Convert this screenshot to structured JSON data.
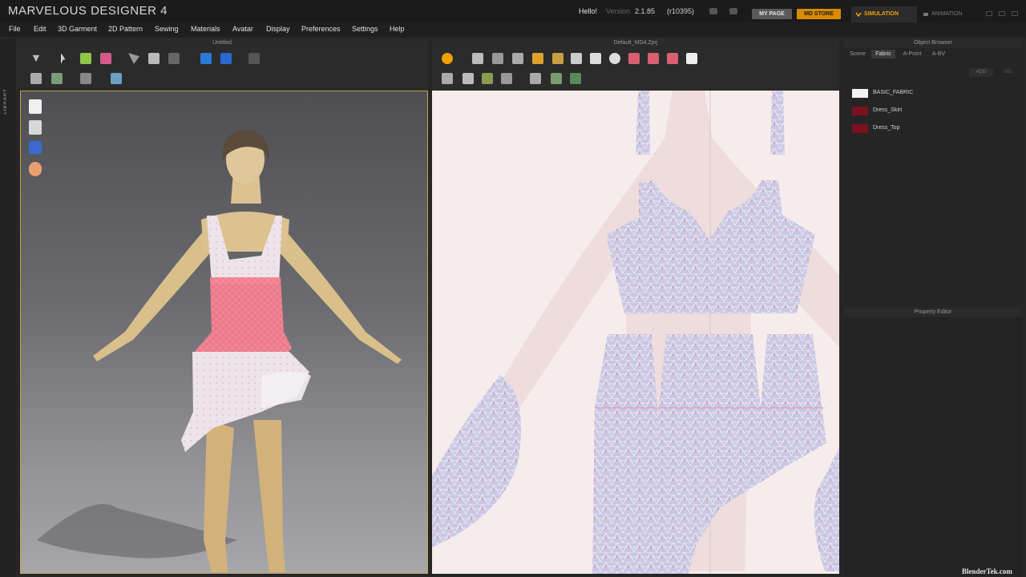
{
  "titlebar": {
    "app_title": "MARVELOUS DESIGNER 4",
    "greeting": "Hello!",
    "version_label": "Version",
    "version_value": "2.1.85",
    "build_value": "(r10395)",
    "mypage_label": "MY PAGE",
    "mdstore_label": "MD STORE",
    "simulation_tab": "SIMULATION",
    "animation_tab": "ANIMATION"
  },
  "menu": {
    "items": [
      "File",
      "Edit",
      "3D Garment",
      "2D Pattern",
      "Sewing",
      "Materials",
      "Avatar",
      "Display",
      "Preferences",
      "Settings",
      "Help"
    ]
  },
  "library": {
    "label": "LIBRARY"
  },
  "view3d": {
    "title": "Untitled"
  },
  "view2d": {
    "title": "Default_MD4.Zprj"
  },
  "object_browser": {
    "title": "Object Browser",
    "tabs": [
      "Scene",
      "Fabric",
      "A-Point",
      "A-BV"
    ],
    "active_tab": "Fabric",
    "add_label": "ADD",
    "delete_label": "DEL",
    "fabrics": [
      {
        "name": "BASIC_FABRIC",
        "color": "#f2f2f2"
      },
      {
        "name": "Dress_Skirt",
        "color": "#7a1020"
      },
      {
        "name": "Dress_Top",
        "color": "#7a1020"
      }
    ]
  },
  "property_editor": {
    "title": "Property Editor"
  },
  "watermark": "BlenderTek.com",
  "colors": {
    "accent": "#f0a000",
    "store": "#d98b00",
    "viewport_border": "#c8a050",
    "pattern_fill": "#c9c7e2"
  }
}
